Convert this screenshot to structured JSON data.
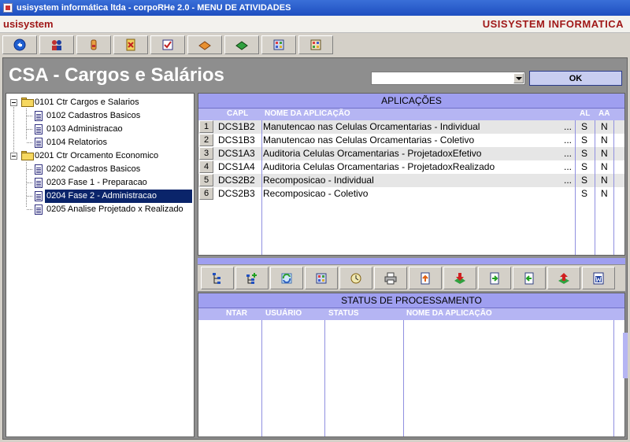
{
  "window": {
    "title": "usisystem informática ltda - corpoRHe 2.0 - MENU DE ATIVIDADES"
  },
  "brand": {
    "left": "usisystem",
    "right": "USISYSTEM INFORMATICA"
  },
  "topbar": {
    "buttons": [
      {
        "icon": "back-icon"
      },
      {
        "icon": "users-icon"
      },
      {
        "icon": "hand-icon"
      },
      {
        "icon": "exit-door-icon"
      },
      {
        "icon": "checklist-icon"
      },
      {
        "icon": "book-icon"
      },
      {
        "icon": "green-book-icon"
      },
      {
        "icon": "calculator-icon"
      },
      {
        "icon": "calculator-alt-icon"
      }
    ]
  },
  "header": {
    "title": "CSA - Cargos e Salários",
    "combo_value": "",
    "ok_label": "OK"
  },
  "tree": {
    "items": [
      {
        "label": "0101 Ctr Cargos e Salarios",
        "level": 0,
        "type": "folder"
      },
      {
        "label": "0102 Cadastros Basicos",
        "level": 1,
        "type": "doc"
      },
      {
        "label": "0103 Administracao",
        "level": 1,
        "type": "doc"
      },
      {
        "label": "0104 Relatorios",
        "level": 1,
        "type": "doc"
      },
      {
        "label": "0201 Ctr Orcamento Economico",
        "level": 0,
        "type": "folder"
      },
      {
        "label": "0202 Cadastros Basicos",
        "level": 1,
        "type": "doc"
      },
      {
        "label": "0203 Fase 1 - Preparacao",
        "level": 1,
        "type": "doc"
      },
      {
        "label": "0204 Fase 2 - Administracao",
        "level": 1,
        "type": "doc",
        "selected": true
      },
      {
        "label": "0205 Analise Projetado x Realizado",
        "level": 1,
        "type": "doc"
      }
    ]
  },
  "applications": {
    "title": "APLICAÇÕES",
    "columns": {
      "capl": "CAPL",
      "nome": "NOME DA APLICAÇÃO",
      "al": "AL",
      "aa": "AA"
    },
    "rows": [
      {
        "num": "1",
        "capl": "DCS1B2",
        "nome": "Manutencao nas Celulas Orcamentarias - Individual",
        "ellipsis": "...",
        "al": "S",
        "aa": "N"
      },
      {
        "num": "2",
        "capl": "DCS1B3",
        "nome": "Manutencao nas Celulas Orcamentarias - Coletivo",
        "ellipsis": "...",
        "al": "S",
        "aa": "N"
      },
      {
        "num": "3",
        "capl": "DCS1A3",
        "nome": "Auditoria Celulas Orcamentarias - ProjetadoxEfetivo",
        "ellipsis": "...",
        "al": "S",
        "aa": "N"
      },
      {
        "num": "4",
        "capl": "DCS1A4",
        "nome": "Auditoria Celulas Orcamentarias - ProjetadoxRealizado",
        "ellipsis": "...",
        "al": "S",
        "aa": "N"
      },
      {
        "num": "5",
        "capl": "DCS2B2",
        "nome": "Recomposicao - Individual",
        "ellipsis": "...",
        "al": "S",
        "aa": "N"
      },
      {
        "num": "6",
        "capl": "DCS2B3",
        "nome": "Recomposicao - Coletivo",
        "ellipsis": "",
        "al": "S",
        "aa": "N"
      }
    ]
  },
  "toolbar2": {
    "buttons": [
      {
        "icon": "tree-view-icon"
      },
      {
        "icon": "tree-add-icon"
      },
      {
        "icon": "refresh-icon"
      },
      {
        "icon": "calculator-icon"
      },
      {
        "icon": "clock-icon"
      },
      {
        "icon": "printer-icon"
      },
      {
        "icon": "document-up-icon"
      },
      {
        "icon": "red-arrow-down-icon"
      },
      {
        "icon": "document-in-icon"
      },
      {
        "icon": "document-out-icon"
      },
      {
        "icon": "red-arrow-up-icon"
      },
      {
        "icon": "word-icon"
      }
    ]
  },
  "status": {
    "title": "STATUS DE PROCESSAMENTO",
    "columns": {
      "ntar": "NTAR",
      "usuario": "USUÁRIO",
      "status": "STATUS",
      "nome": "NOME DA APLICAÇÃO"
    }
  }
}
